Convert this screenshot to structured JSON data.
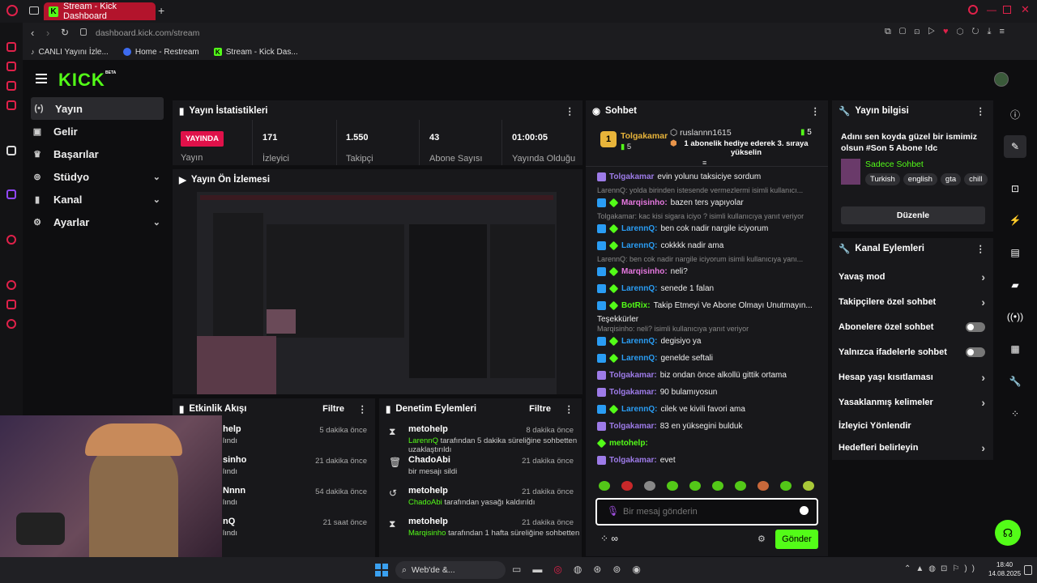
{
  "browser": {
    "tab_title": "Stream - Kick Dashboard",
    "url_host": "dashboard.kick.com",
    "url_path": "/stream",
    "bookmarks": [
      "CANLI Yayını İzle...",
      "Home - Restream",
      "Stream - Kick Das..."
    ]
  },
  "app": {
    "logo": "KICK",
    "beta": "BETA"
  },
  "sidebar": {
    "items": [
      "Yayın",
      "Gelir",
      "Başarılar",
      "Stüdyo",
      "Kanal",
      "Ayarlar"
    ]
  },
  "stats": {
    "title": "Yayın İstatistikleri",
    "live_badge": "YAYINDA",
    "live_label": "Yayın",
    "items": [
      {
        "value": "171",
        "label": "İzleyici"
      },
      {
        "value": "1.550",
        "label": "Takipçi"
      },
      {
        "value": "43",
        "label": "Abone Sayısı"
      },
      {
        "value": "01:00:05",
        "label": "Yayında Olduğu"
      }
    ]
  },
  "preview": {
    "title": "Yayın Ön İzlemesi"
  },
  "activity": {
    "title": "Etkinlik Akışı",
    "filter": "Filtre",
    "items": [
      {
        "name": "help",
        "desc": "lındı",
        "time": "5 dakika önce"
      },
      {
        "name": "sinho",
        "desc": "lındı",
        "time": "21 dakika önce"
      },
      {
        "name": "Nnnn",
        "desc": "lındı",
        "time": "54 dakika önce"
      },
      {
        "name": "nQ",
        "desc": "lındı",
        "time": "21 saat önce"
      }
    ]
  },
  "moderation": {
    "title": "Denetim Eylemleri",
    "filter": "Filtre",
    "items": [
      {
        "name": "metohelp",
        "actor": "LarennQ",
        "desc": "tarafından 5 dakika süreliğine sohbetten uzaklaştırıldı",
        "time": "8 dakika önce"
      },
      {
        "name": "ChadoAbi",
        "actor": "",
        "desc": "bir mesajı sildi",
        "time": "21 dakika önce"
      },
      {
        "name": "metohelp",
        "actor": "ChadoAbi",
        "desc": "tarafından yasağı kaldırıldı",
        "time": "21 dakika önce"
      },
      {
        "name": "metohelp",
        "actor": "Marqisinho",
        "desc": "tarafından 1 hafta süreliğine sohbetten",
        "time": "21 dakika önce"
      }
    ]
  },
  "chat": {
    "title": "Sohbet",
    "top_gifter": {
      "rank": "1",
      "name": "Tolgakamar",
      "count": "5"
    },
    "gift_user": "ruslannn1615",
    "gift_count": "5",
    "gift_text": "1 abonelik hediye ederek 3. sıraya yükselin",
    "messages": [
      {
        "type": "msg",
        "badge": "purple",
        "user": "Tolgakamar",
        "color": "#9d7be8",
        "text": "evin yolunu taksiciye sordum"
      },
      {
        "type": "reply",
        "text": "LarennQ: yolda birinden istesende vermezlermi isimli kullanıcı..."
      },
      {
        "type": "msg",
        "badge": "blue-green",
        "user": "Marqisinho:",
        "color": "#e678e0",
        "text": "bazen ters yapıyolar"
      },
      {
        "type": "reply",
        "text": "Tolgakamar: kac kisi sigara iciyo ? isimli kullanıcıya yanıt veriyor"
      },
      {
        "type": "msg",
        "badge": "blue-green",
        "user": "LarennQ:",
        "color": "#2a9df4",
        "text": "ben cok nadir nargile iciyorum"
      },
      {
        "type": "msg",
        "badge": "blue-green",
        "user": "LarennQ:",
        "color": "#2a9df4",
        "text": "cokkkk nadir ama"
      },
      {
        "type": "reply",
        "text": "LarennQ: ben cok nadir nargile iciyorum isimli kullanıcıya yanı..."
      },
      {
        "type": "msg",
        "badge": "blue-green",
        "user": "Marqisinho:",
        "color": "#e678e0",
        "text": "neli?"
      },
      {
        "type": "msg",
        "badge": "blue-green",
        "user": "LarennQ:",
        "color": "#2a9df4",
        "text": "senede 1 falan"
      },
      {
        "type": "msg",
        "badge": "blue-green",
        "user": "BotRix:",
        "color": "#53fc18",
        "text": "Takip Etmeyi Ve Abone Olmayı Unutmayın..."
      },
      {
        "type": "cont",
        "text": "Teşekkürler"
      },
      {
        "type": "reply",
        "text": "Marqisinho: neli? isimli kullanıcıya yanıt veriyor"
      },
      {
        "type": "msg",
        "badge": "blue-green",
        "user": "LarennQ:",
        "color": "#2a9df4",
        "text": "degisiyo ya"
      },
      {
        "type": "msg",
        "badge": "blue-green",
        "user": "LarennQ:",
        "color": "#2a9df4",
        "text": "genelde seftali"
      },
      {
        "type": "msg",
        "badge": "purple",
        "user": "Tolgakamar:",
        "color": "#9d7be8",
        "text": "biz ondan önce alkollü gittik ortama"
      },
      {
        "type": "msg",
        "badge": "purple",
        "user": "Tolgakamar:",
        "color": "#9d7be8",
        "text": "90 bulamıyosun"
      },
      {
        "type": "msg",
        "badge": "blue-green",
        "user": "LarennQ:",
        "color": "#2a9df4",
        "text": "cilek ve kivili favori ama"
      },
      {
        "type": "msg",
        "badge": "purple",
        "user": "Tolgakamar:",
        "color": "#9d7be8",
        "text": "83 en yüksegini bulduk"
      },
      {
        "type": "msg",
        "badge": "green",
        "user": "metohelp:",
        "color": "#53fc18",
        "text": ""
      },
      {
        "type": "msg",
        "badge": "purple",
        "user": "Tolgakamar:",
        "color": "#9d7be8",
        "text": "evet"
      }
    ],
    "input_placeholder": "Bir mesaj gönderin",
    "send": "Gönder"
  },
  "info": {
    "title": "Yayın bilgisi",
    "stream_title": "Adını sen koyda güzel bir ismimiz olsun #Son 5 Abone !dc",
    "category": "Sadece Sohbet",
    "tags": [
      "Turkish",
      "english",
      "gta",
      "chill"
    ],
    "edit": "Düzenle"
  },
  "channel_actions": {
    "title": "Kanal Eylemleri",
    "items": [
      {
        "label": "Yavaş mod",
        "control": "chevron"
      },
      {
        "label": "Takipçilere özel sohbet",
        "control": "chevron"
      },
      {
        "label": "Abonelere özel sohbet",
        "control": "toggle"
      },
      {
        "label": "Yalnızca ifadelerle sohbet",
        "control": "toggle"
      },
      {
        "label": "Hesap yaşı kısıtlaması",
        "control": "chevron"
      },
      {
        "label": "Yasaklanmış kelimeler",
        "control": "chevron"
      },
      {
        "label": "İzleyici Yönlendir",
        "control": "none"
      },
      {
        "label": "Hedefleri belirleyin",
        "control": "chevron"
      }
    ]
  },
  "taskbar": {
    "search": "Web'de &...",
    "time": "18:40",
    "date": "14.08.2025"
  },
  "colors": {
    "accent": "#53fc18",
    "live": "#e0114a",
    "panel": "#18181b"
  }
}
